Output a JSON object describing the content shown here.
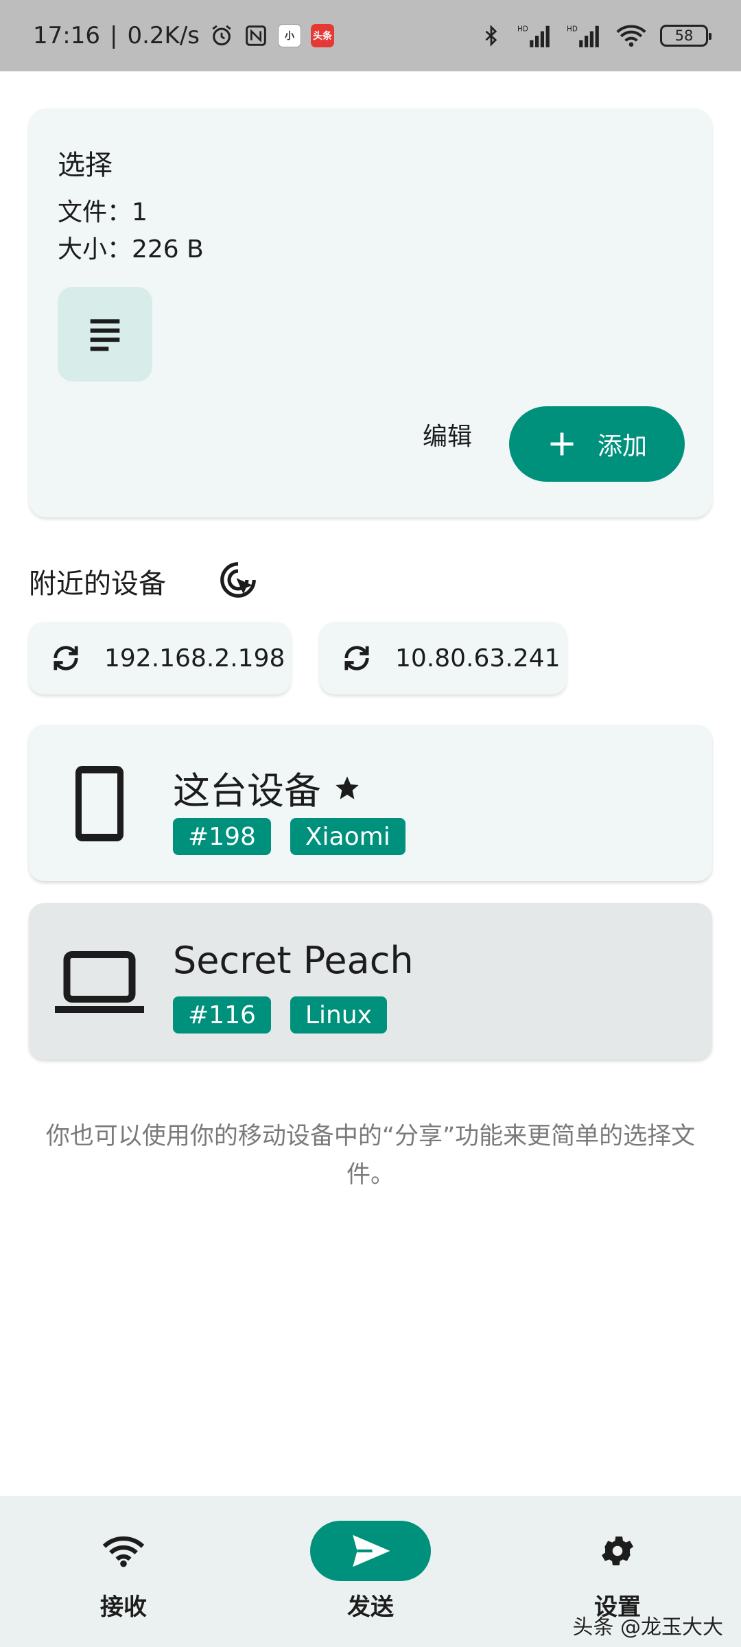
{
  "status_bar": {
    "time": "17:16",
    "net_speed": "0.2K/s",
    "app_icon_1": "小",
    "app_icon_2": "头条",
    "battery": "58"
  },
  "selection": {
    "title": "选择",
    "files": "文件：1",
    "size": "大小：226 B",
    "edit_label": "编辑",
    "add_label": "添加"
  },
  "nearby": {
    "title": "附近的设备",
    "ips": [
      "192.168.2.198",
      "10.80.63.241"
    ]
  },
  "devices": [
    {
      "name": "这台设备",
      "starred": true,
      "tags": [
        "#198",
        "Xiaomi"
      ],
      "icon": "phone-icon"
    },
    {
      "name": "Secret Peach",
      "starred": false,
      "tags": [
        "#116",
        "Linux"
      ],
      "icon": "laptop-icon"
    }
  ],
  "hint": "你也可以使用你的移动设备中的“分享”功能来更简单的选择文件。",
  "bottom_nav": {
    "items": [
      {
        "label": "接收",
        "icon": "wifi-icon",
        "active": false
      },
      {
        "label": "发送",
        "icon": "send-icon",
        "active": true
      },
      {
        "label": "设置",
        "icon": "gear-icon",
        "active": false
      }
    ]
  },
  "watermark": "头条 @龙玉大大",
  "colors": {
    "accent": "#00917c",
    "card": "#f1f6f6"
  }
}
